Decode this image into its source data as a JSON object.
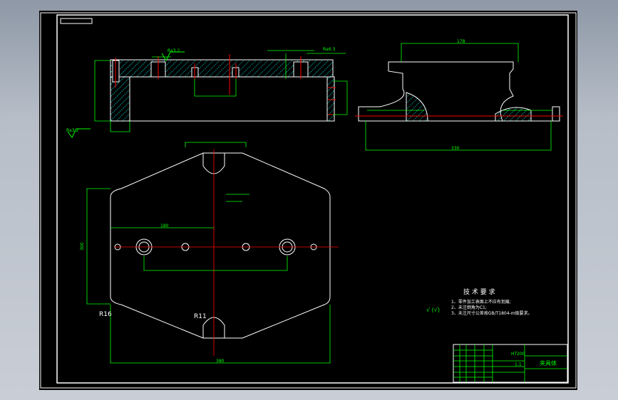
{
  "drawing": {
    "colors": {
      "outline": "#ffffff",
      "dimension": "#00ff00",
      "centerline": "#ff0000",
      "hatch": "#00ffff",
      "background": "#000000"
    },
    "roughness_top": "Ra3.2",
    "roughness_bottom": "Ra3.2",
    "roughness_right": "Ra6.3",
    "radius_left": "R16",
    "radius_center": "R11",
    "dims": {
      "overall_width": "380",
      "overall_height": "300",
      "hole_span": "180",
      "right_view_width": "330",
      "right_view_inner": "178"
    },
    "tech_requirements": {
      "title": "技 术 要 求",
      "items": [
        "1、零件加工表面上不应有划痕;",
        "2、未注倒角为C1;",
        "3、未注尺寸公差按GB/T1804-m级要求。"
      ]
    },
    "roughness_symbol": "√ (√)",
    "title_block": {
      "material": "HT200",
      "part_name": "夹具体",
      "scale": "1:1"
    }
  }
}
